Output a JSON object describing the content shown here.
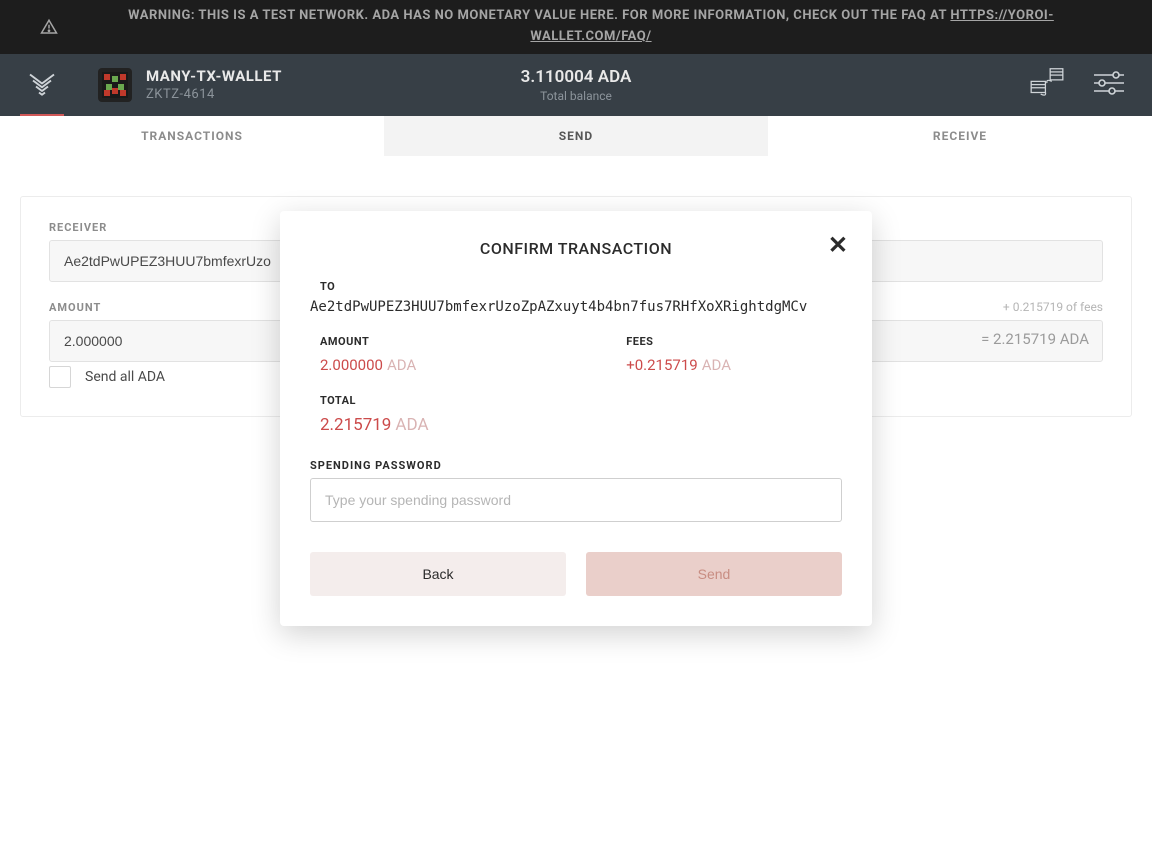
{
  "warning": {
    "prefix": "WARNING: THIS IS A TEST NETWORK. ADA HAS NO MONETARY VALUE HERE. FOR MORE INFORMATION, CHECK OUT THE FAQ AT ",
    "link_text": "HTTPS://YOROI-WALLET.COM/FAQ/"
  },
  "header": {
    "wallet_name": "MANY-TX-WALLET",
    "wallet_id": "ZKTZ-4614",
    "balance_amount": "3.110004 ADA",
    "balance_label": "Total balance"
  },
  "tabs": {
    "transactions": "TRANSACTIONS",
    "send": "SEND",
    "receive": "RECEIVE"
  },
  "form": {
    "receiver_label": "RECEIVER",
    "receiver_value": "Ae2tdPwUPEZ3HUU7bmfexrUzo",
    "amount_label": "AMOUNT",
    "amount_value": "2.000000",
    "fees_hint": "+ 0.215719 of fees",
    "total_hint": "= 2.215719 ADA",
    "send_all_label": "Send all ADA"
  },
  "modal": {
    "title": "CONFIRM TRANSACTION",
    "to_label": "TO",
    "to_value": "Ae2tdPwUPEZ3HUU7bmfexrUzoZpAZxuyt4b4bn7fus7RHfXoXRightdgMCv",
    "amount_label": "AMOUNT",
    "amount_value": "2.000000",
    "fees_label": "FEES",
    "fees_value": "+0.215719",
    "total_label": "TOTAL",
    "total_value": "2.215719",
    "currency": "ADA",
    "password_label": "SPENDING PASSWORD",
    "password_placeholder": "Type your spending password",
    "back_label": "Back",
    "send_label": "Send"
  }
}
